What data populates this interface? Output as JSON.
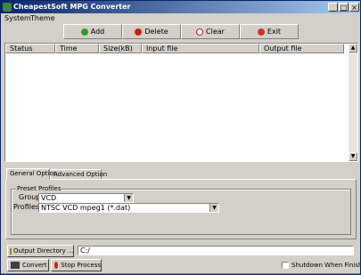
{
  "window": {
    "title": "CheapestSoft MPG Converter"
  },
  "menu": [
    {
      "label": "System"
    },
    {
      "label": "Theme"
    }
  ],
  "toolbar": {
    "add_label": "Add",
    "delete_label": "Delete",
    "clear_label": "Clear",
    "exit_label": "Exit",
    "colors": {
      "add": "#2e9b2e",
      "delete": "#c81e1e",
      "clear": "#b0b0c0",
      "exit": "#d03030"
    }
  },
  "list": {
    "columns": [
      "Status",
      "Time",
      "Size(kB)",
      "Input file",
      "Output file"
    ],
    "rows": []
  },
  "tabs": [
    {
      "label": "General Option"
    },
    {
      "label": "Advanced Option"
    }
  ],
  "preset": {
    "group_title": "Preset Profiles",
    "group_label": "Group:",
    "group_value": "VCD",
    "profiles_label": "Profiles:",
    "profiles_value": "NTSC VCD mpeg1 (*.dat)"
  },
  "output": {
    "button_label": "Output Directory ...",
    "path": "C:/"
  },
  "actions": {
    "convert_label": "Convert",
    "stop_label": "Stop Process",
    "shutdown_label": "Shutdown When Finished",
    "shutdown_checked": false
  }
}
